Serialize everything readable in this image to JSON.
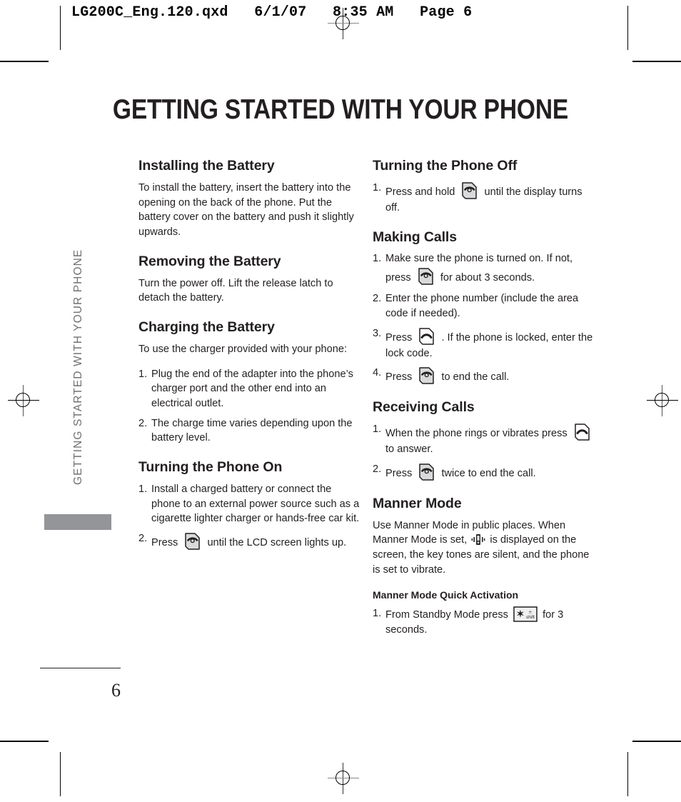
{
  "document": {
    "file_slug": "LG200C_Eng.120.qxd   6/1/07   8:35 AM   Page 6",
    "title": "GETTING STARTED WITH YOUR PHONE",
    "side_tab_label": "GETTING STARTED WITH YOUR PHONE",
    "page_number": "6"
  },
  "colors": {
    "text": "#231f20",
    "side_tab_gray": "#939598",
    "side_label_gray": "#6f7072",
    "key_fill": "#d9dadb"
  },
  "icons": {
    "end_key": "end-call-key-icon",
    "send_key": "send-call-key-icon",
    "star_shift_key": "star-shift-key-icon",
    "star_glyph": "✶",
    "star_key_label": "shift",
    "manner_mode": "vibrate-mode-icon"
  },
  "left_column": {
    "sections": [
      {
        "heading": "Installing the Battery",
        "paragraphs": [
          "To install the battery, insert the battery into the opening on the back of the phone. Put the battery cover on the battery and push it slightly upwards."
        ]
      },
      {
        "heading": "Removing the Battery",
        "paragraphs": [
          "Turn the power off. Lift the release latch to detach the battery."
        ]
      },
      {
        "heading": "Charging the Battery",
        "paragraphs": [
          "To use the charger provided with your phone:"
        ],
        "steps": [
          "Plug the end of the adapter into the phone’s charger port and the other end into an electrical outlet.",
          "The charge time varies depending upon the battery level."
        ]
      },
      {
        "heading": "Turning the Phone On",
        "steps": [
          "Install a charged battery or connect the phone to an external power source such as a cigarette lighter charger or hands-free car kit."
        ],
        "step2_prefix": "Press",
        "step2_suffix": "until the LCD screen lights up."
      }
    ]
  },
  "right_column": {
    "sections": [
      {
        "heading": "Turning the Phone Off",
        "step1_prefix": "Press and hold",
        "step1_suffix": "until the display turns off."
      },
      {
        "heading": "Making Calls",
        "step1_prefix": "Make sure the phone is turned on. If not, press",
        "step1_suffix": "for about 3 seconds.",
        "step2": "Enter the phone number (include the area code if needed).",
        "step3_prefix": "Press",
        "step3_suffix": ". If the phone is locked, enter the lock code.",
        "step4_prefix": "Press",
        "step4_suffix": "to end the call."
      },
      {
        "heading": "Receiving Calls",
        "step1_prefix": "When the phone rings or vibrates press",
        "step1_suffix": "to answer.",
        "step2_prefix": "Press",
        "step2_suffix": "twice to end the call."
      },
      {
        "heading": "Manner Mode",
        "para_part1": "Use Manner Mode in public places. When Manner Mode is set,",
        "para_part2": "is displayed on the screen, the key tones are silent, and the phone is set to vibrate.",
        "sub_heading": "Manner Mode Quick Activation",
        "step1_prefix": "From Standby Mode press",
        "step1_suffix": "for 3 seconds."
      }
    ]
  }
}
